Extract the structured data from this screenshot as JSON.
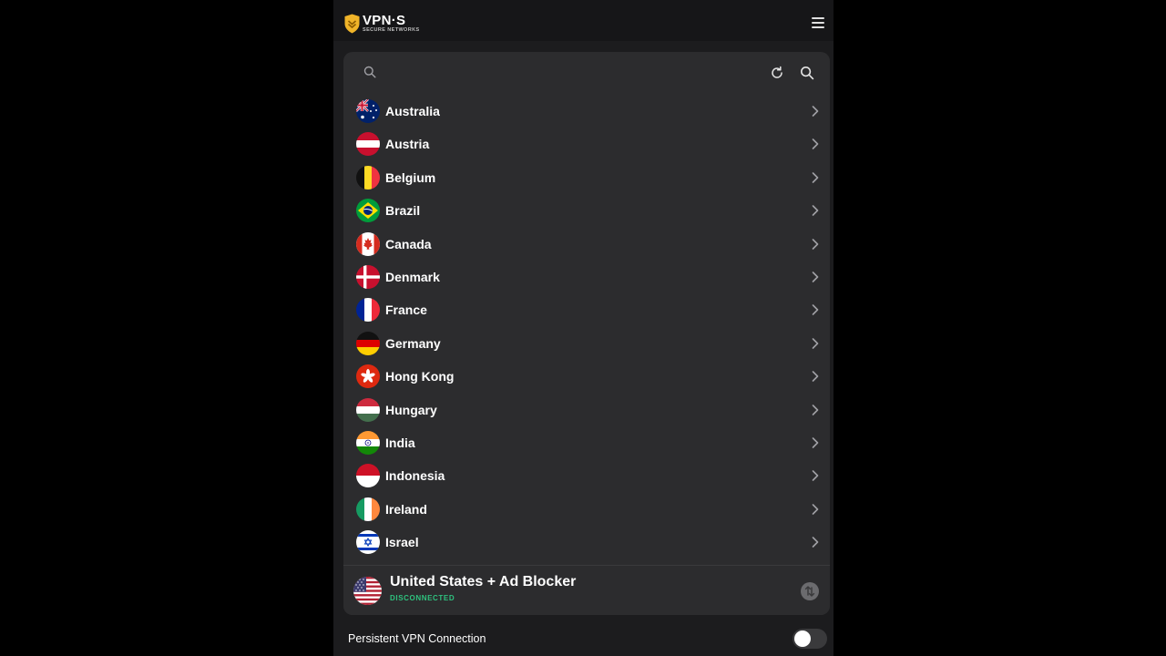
{
  "header": {
    "logo_title": "VPN·S",
    "logo_subtitle": "SECURE NETWORKS",
    "menu_icon": "hamburger-icon"
  },
  "search": {
    "value": "",
    "placeholder": "",
    "left_icon": "search-icon",
    "refresh_icon": "refresh-icon",
    "search_button_icon": "search-icon"
  },
  "countries": [
    {
      "name": "Australia",
      "flag": "australia-flag-icon"
    },
    {
      "name": "Austria",
      "flag": "austria-flag-icon"
    },
    {
      "name": "Belgium",
      "flag": "belgium-flag-icon"
    },
    {
      "name": "Brazil",
      "flag": "brazil-flag-icon"
    },
    {
      "name": "Canada",
      "flag": "canada-flag-icon"
    },
    {
      "name": "Denmark",
      "flag": "denmark-flag-icon"
    },
    {
      "name": "France",
      "flag": "france-flag-icon"
    },
    {
      "name": "Germany",
      "flag": "germany-flag-icon"
    },
    {
      "name": "Hong Kong",
      "flag": "hong-kong-flag-icon"
    },
    {
      "name": "Hungary",
      "flag": "hungary-flag-icon"
    },
    {
      "name": "India",
      "flag": "india-flag-icon"
    },
    {
      "name": "Indonesia",
      "flag": "indonesia-flag-icon"
    },
    {
      "name": "Ireland",
      "flag": "ireland-flag-icon"
    },
    {
      "name": "Israel",
      "flag": "israel-flag-icon"
    }
  ],
  "connection": {
    "location": "United States + Ad Blocker",
    "status": "DISCONNECTED",
    "status_color": "#2ec27e",
    "flag": "united-states-flag-icon",
    "button_icon": "connect-arrows-icon"
  },
  "settings": {
    "persistent_label": "Persistent VPN Connection",
    "persistent_enabled": false
  },
  "colors": {
    "background": "#1c1c1e",
    "card": "#2c2c2e",
    "logo_accent": "#f0b429"
  }
}
